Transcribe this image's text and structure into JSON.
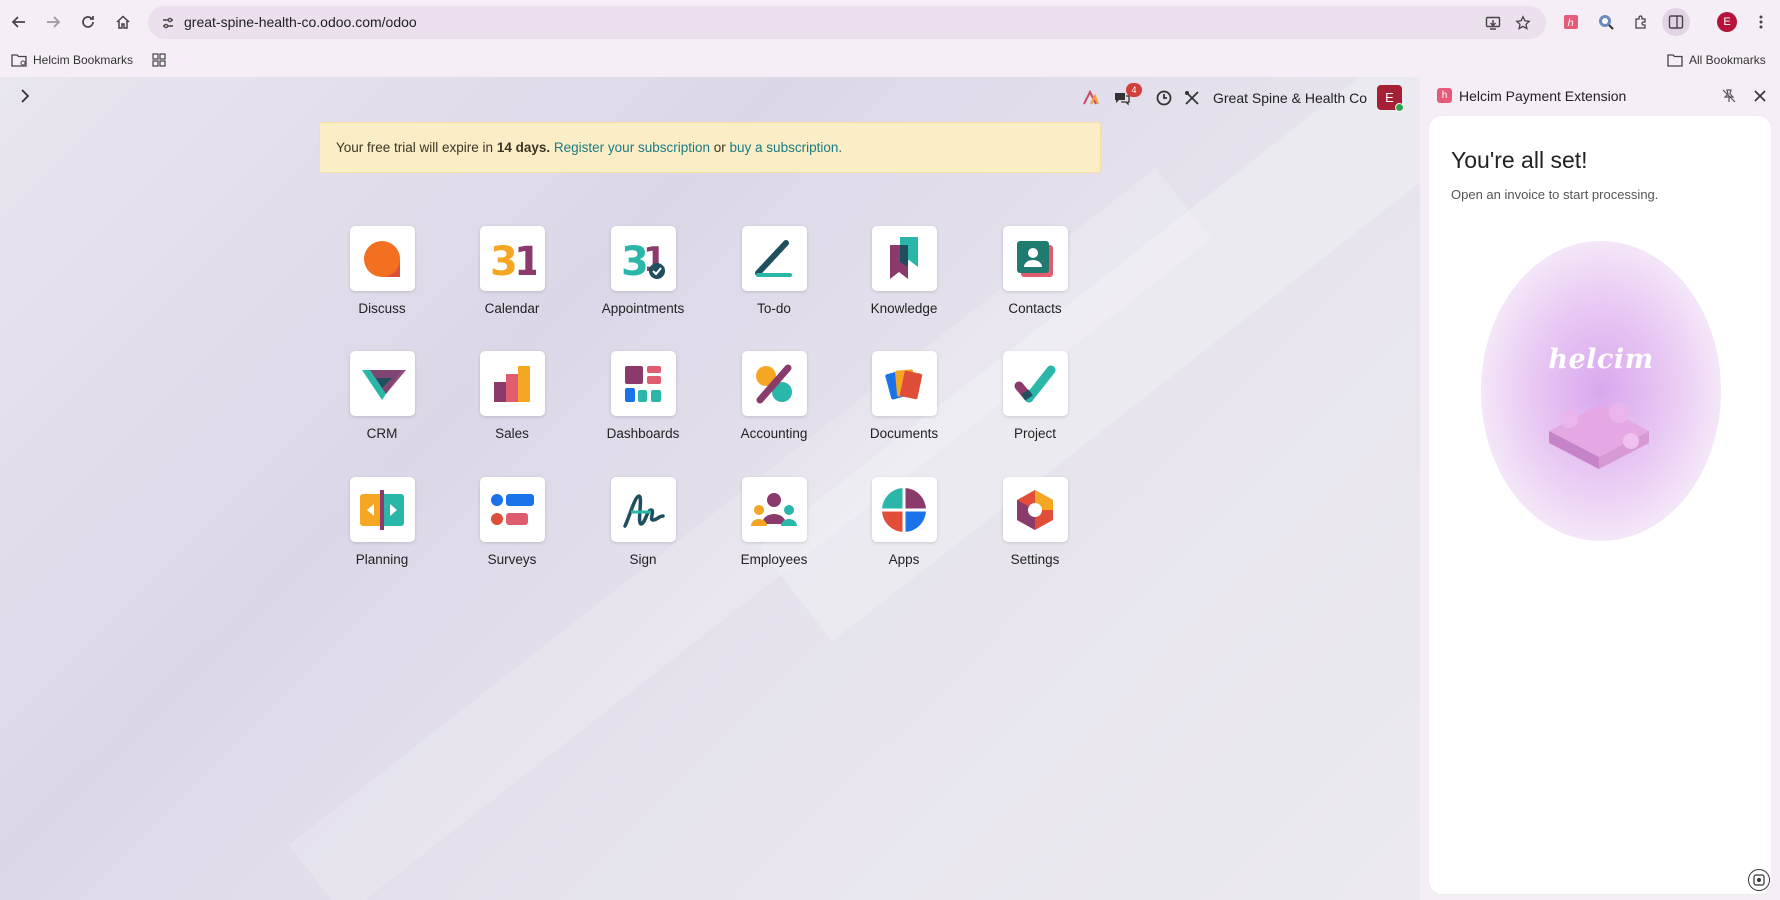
{
  "browser": {
    "url": "great-spine-health-co.odoo.com/odoo",
    "profile_initial": "E"
  },
  "bookmarks_bar": {
    "left_folder": "Helcim Bookmarks",
    "right_folder": "All Bookmarks"
  },
  "odoo": {
    "company": "Great Spine & Health Co",
    "user_initial": "E",
    "messages_count": "4",
    "trial_banner": {
      "prefix": "Your free trial will expire in",
      "days": "14 days.",
      "register_link": "Register your subscription",
      "or": "or",
      "buy_link": "buy a subscription."
    },
    "apps": [
      {
        "label": "Discuss"
      },
      {
        "label": "Calendar"
      },
      {
        "label": "Appointments"
      },
      {
        "label": "To-do"
      },
      {
        "label": "Knowledge"
      },
      {
        "label": "Contacts"
      },
      {
        "label": "CRM"
      },
      {
        "label": "Sales"
      },
      {
        "label": "Dashboards"
      },
      {
        "label": "Accounting"
      },
      {
        "label": "Documents"
      },
      {
        "label": "Project"
      },
      {
        "label": "Planning"
      },
      {
        "label": "Surveys"
      },
      {
        "label": "Sign"
      },
      {
        "label": "Employees"
      },
      {
        "label": "Apps"
      },
      {
        "label": "Settings"
      }
    ]
  },
  "side_panel": {
    "title": "Helcim Payment Extension",
    "heading": "You're all set!",
    "subtext": "Open an invoice to start processing.",
    "brand_word": "helcim"
  },
  "colors": {
    "odoo_accent": "#1b7b82",
    "banner_bg": "#fbedc6",
    "badge_red": "#d23f3a"
  }
}
